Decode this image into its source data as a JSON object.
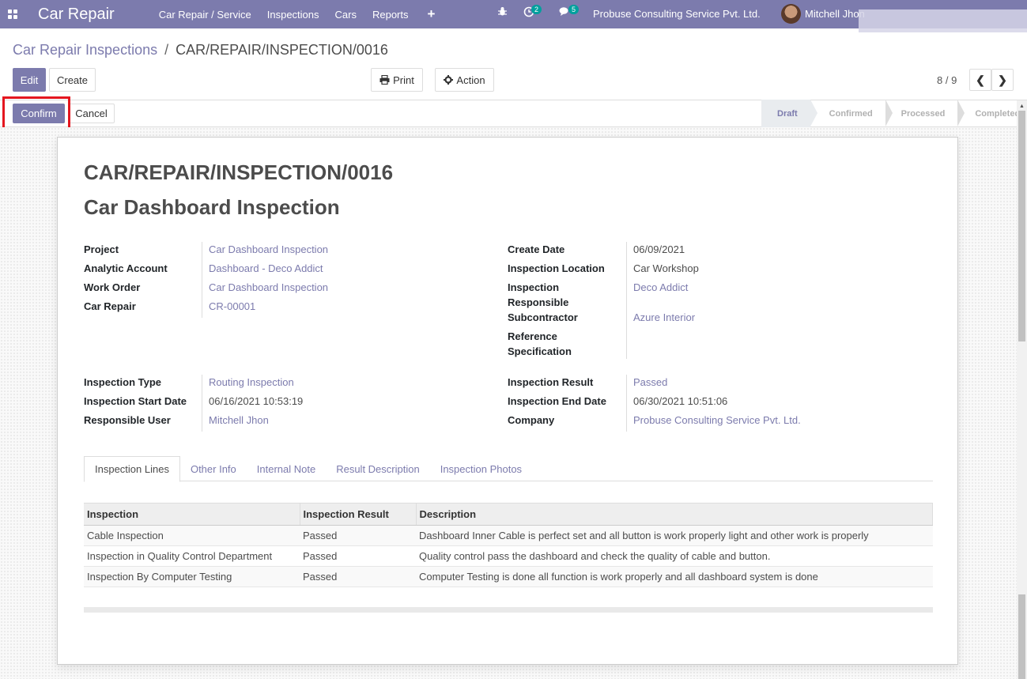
{
  "navbar": {
    "app_name": "Car Repair",
    "menu": [
      "Car Repair / Service",
      "Inspections",
      "Cars",
      "Reports"
    ],
    "activity_count": "2",
    "message_count": "5",
    "company": "Probuse Consulting Service Pvt. Ltd.",
    "user": "Mitchell Jhon"
  },
  "breadcrumb": {
    "parent": "Car Repair Inspections",
    "separator": "/",
    "current": "CAR/REPAIR/INSPECTION/0016"
  },
  "toolbar": {
    "edit": "Edit",
    "create": "Create",
    "print": "Print",
    "action": "Action",
    "pager": "8 / 9"
  },
  "statusbar": {
    "confirm": "Confirm",
    "cancel": "Cancel",
    "stages": [
      "Draft",
      "Confirmed",
      "Processed",
      "Completed"
    ],
    "active_stage": "Draft"
  },
  "form": {
    "reference": "CAR/REPAIR/INSPECTION/0016",
    "name": "Car Dashboard Inspection",
    "left_fields": [
      {
        "label": "Project",
        "value": "Car Dashboard Inspection"
      },
      {
        "label": "Analytic Account",
        "value": "Dashboard - Deco Addict"
      },
      {
        "label": "Work Order",
        "value": "Car Dashboard Inspection"
      },
      {
        "label": "Car Repair",
        "value": "CR-00001"
      }
    ],
    "right_fields": [
      {
        "label": "Create Date",
        "value": "06/09/2021"
      },
      {
        "label": "Inspection Location",
        "value": "Car Workshop"
      },
      {
        "label": "Inspection Responsible",
        "value": "Deco Addict"
      },
      {
        "label": "Subcontractor",
        "value": "Azure Interior"
      },
      {
        "label": "Reference Specification",
        "value": ""
      }
    ],
    "left_fields2": [
      {
        "label": "Inspection Type",
        "value": "Routing Inspection"
      },
      {
        "label": "Inspection Start Date",
        "value": "06/16/2021 10:53:19"
      },
      {
        "label": "Responsible User",
        "value": "Mitchell Jhon"
      }
    ],
    "right_fields2": [
      {
        "label": "Inspection Result",
        "value": "Passed"
      },
      {
        "label": "Inspection End Date",
        "value": "06/30/2021 10:51:06"
      },
      {
        "label": "Company",
        "value": "Probuse Consulting Service Pvt. Ltd."
      }
    ],
    "tabs": [
      "Inspection Lines",
      "Other Info",
      "Internal Note",
      "Result Description",
      "Inspection Photos"
    ],
    "table": {
      "headers": [
        "Inspection",
        "Inspection Result",
        "Description"
      ],
      "rows": [
        [
          "Cable Inspection",
          "Passed",
          "Dashboard Inner Cable is perfect set and all button is work properly light and other work is properly"
        ],
        [
          "Inspection in Quality Control Department",
          "Passed",
          "Quality control pass the dashboard and check the quality of cable and button."
        ],
        [
          "Inspection By Computer Testing",
          "Passed",
          "Computer Testing is done all function is work properly and all dashboard system is done"
        ]
      ]
    }
  },
  "colors": {
    "brand": "#7c7bad",
    "highlight": "#e4161f"
  }
}
